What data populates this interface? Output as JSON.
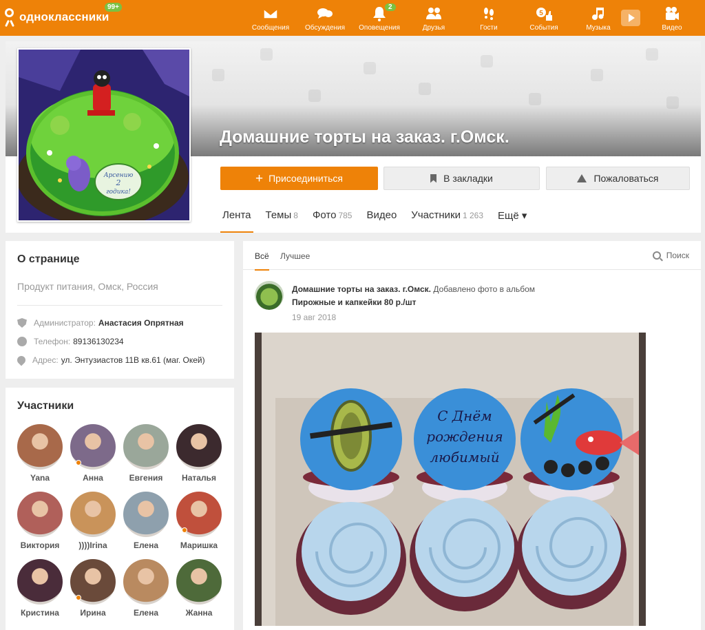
{
  "topbar": {
    "logo_text": "одноклассники",
    "logo_badge": "99+",
    "nav": [
      {
        "label": "Сообщения",
        "icon": "envelope-icon"
      },
      {
        "label": "Обсуждения",
        "icon": "speech-bubbles-icon"
      },
      {
        "label": "Оповещения",
        "icon": "bell-icon",
        "badge": "2"
      },
      {
        "label": "Друзья",
        "icon": "people-icon"
      },
      {
        "label": "Гости",
        "icon": "footprints-icon"
      },
      {
        "label": "События",
        "icon": "thumbs-up-five-icon"
      },
      {
        "label": "Музыка",
        "icon": "music-note-icon"
      },
      {
        "label": "Видео",
        "icon": "video-camera-icon"
      }
    ]
  },
  "group": {
    "title": "Домашние торты на заказ. г.Омск.",
    "join_label": "Присоединиться",
    "bookmark_label": "В закладки",
    "report_label": "Пожаловаться",
    "tabs": [
      {
        "label": "Лента",
        "count": ""
      },
      {
        "label": "Темы",
        "count": "8"
      },
      {
        "label": "Фото",
        "count": "785"
      },
      {
        "label": "Видео",
        "count": ""
      },
      {
        "label": "Участники",
        "count": "1 263"
      },
      {
        "label": "Ещё ▾",
        "count": ""
      }
    ]
  },
  "about": {
    "title": "О странице",
    "category": "Продукт питания, Омск, Россия",
    "admin_label": "Администратор:",
    "admin_value": "Анастасия Опрятная",
    "phone_label": "Телефон:",
    "phone_value": "89136130234",
    "address_label": "Адрес:",
    "address_value": "ул. Энтузиастов 11В кв.61 (маг. Окей)"
  },
  "members": {
    "title": "Участники",
    "list": [
      {
        "name": "Yana",
        "color": "#a8694a",
        "online": false
      },
      {
        "name": "Анна",
        "color": "#7d6a8a",
        "online": true
      },
      {
        "name": "Евгения",
        "color": "#9aa79a",
        "online": false
      },
      {
        "name": "Наталья",
        "color": "#3c2a2e",
        "online": false
      },
      {
        "name": "Виктория",
        "color": "#b0605a",
        "online": false
      },
      {
        "name": "))))Irina",
        "color": "#c9935a",
        "online": false
      },
      {
        "name": "Елена",
        "color": "#8ea0ad",
        "online": false
      },
      {
        "name": "Маришка",
        "color": "#c0503c",
        "online": true
      },
      {
        "name": "Кристина",
        "color": "#4a2c3a",
        "online": false
      },
      {
        "name": "Ирина",
        "color": "#6a4a3a",
        "online": true
      },
      {
        "name": "Елена",
        "color": "#b98a60",
        "online": false
      },
      {
        "name": "Жанна",
        "color": "#4e6a3a",
        "online": false
      }
    ]
  },
  "feed": {
    "tab_all": "Всё",
    "tab_best": "Лучшее",
    "search_label": "Поиск",
    "post": {
      "author": "Домашние торты на заказ. г.Омск.",
      "action": "Добавлено фото в альбом",
      "album": "Пирожные и капкейки 80 р./шт",
      "date": "19 авг 2018"
    },
    "cupcake_text": [
      "С Днём",
      "рождения",
      "любимый"
    ]
  },
  "cake_text": [
    "Арсению",
    "2",
    "годика!"
  ],
  "colors": {
    "accent": "#ee8208",
    "badge": "#7bc142"
  }
}
